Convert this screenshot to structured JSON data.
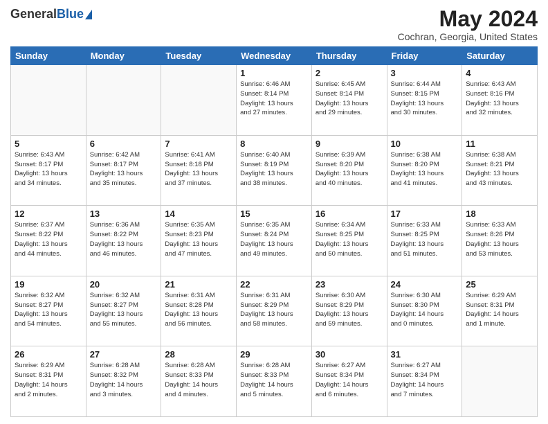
{
  "header": {
    "logo_general": "General",
    "logo_blue": "Blue",
    "month_title": "May 2024",
    "location": "Cochran, Georgia, United States"
  },
  "days_of_week": [
    "Sunday",
    "Monday",
    "Tuesday",
    "Wednesday",
    "Thursday",
    "Friday",
    "Saturday"
  ],
  "weeks": [
    [
      {
        "num": "",
        "info": ""
      },
      {
        "num": "",
        "info": ""
      },
      {
        "num": "",
        "info": ""
      },
      {
        "num": "1",
        "info": "Sunrise: 6:46 AM\nSunset: 8:14 PM\nDaylight: 13 hours\nand 27 minutes."
      },
      {
        "num": "2",
        "info": "Sunrise: 6:45 AM\nSunset: 8:14 PM\nDaylight: 13 hours\nand 29 minutes."
      },
      {
        "num": "3",
        "info": "Sunrise: 6:44 AM\nSunset: 8:15 PM\nDaylight: 13 hours\nand 30 minutes."
      },
      {
        "num": "4",
        "info": "Sunrise: 6:43 AM\nSunset: 8:16 PM\nDaylight: 13 hours\nand 32 minutes."
      }
    ],
    [
      {
        "num": "5",
        "info": "Sunrise: 6:43 AM\nSunset: 8:17 PM\nDaylight: 13 hours\nand 34 minutes."
      },
      {
        "num": "6",
        "info": "Sunrise: 6:42 AM\nSunset: 8:17 PM\nDaylight: 13 hours\nand 35 minutes."
      },
      {
        "num": "7",
        "info": "Sunrise: 6:41 AM\nSunset: 8:18 PM\nDaylight: 13 hours\nand 37 minutes."
      },
      {
        "num": "8",
        "info": "Sunrise: 6:40 AM\nSunset: 8:19 PM\nDaylight: 13 hours\nand 38 minutes."
      },
      {
        "num": "9",
        "info": "Sunrise: 6:39 AM\nSunset: 8:20 PM\nDaylight: 13 hours\nand 40 minutes."
      },
      {
        "num": "10",
        "info": "Sunrise: 6:38 AM\nSunset: 8:20 PM\nDaylight: 13 hours\nand 41 minutes."
      },
      {
        "num": "11",
        "info": "Sunrise: 6:38 AM\nSunset: 8:21 PM\nDaylight: 13 hours\nand 43 minutes."
      }
    ],
    [
      {
        "num": "12",
        "info": "Sunrise: 6:37 AM\nSunset: 8:22 PM\nDaylight: 13 hours\nand 44 minutes."
      },
      {
        "num": "13",
        "info": "Sunrise: 6:36 AM\nSunset: 8:22 PM\nDaylight: 13 hours\nand 46 minutes."
      },
      {
        "num": "14",
        "info": "Sunrise: 6:35 AM\nSunset: 8:23 PM\nDaylight: 13 hours\nand 47 minutes."
      },
      {
        "num": "15",
        "info": "Sunrise: 6:35 AM\nSunset: 8:24 PM\nDaylight: 13 hours\nand 49 minutes."
      },
      {
        "num": "16",
        "info": "Sunrise: 6:34 AM\nSunset: 8:25 PM\nDaylight: 13 hours\nand 50 minutes."
      },
      {
        "num": "17",
        "info": "Sunrise: 6:33 AM\nSunset: 8:25 PM\nDaylight: 13 hours\nand 51 minutes."
      },
      {
        "num": "18",
        "info": "Sunrise: 6:33 AM\nSunset: 8:26 PM\nDaylight: 13 hours\nand 53 minutes."
      }
    ],
    [
      {
        "num": "19",
        "info": "Sunrise: 6:32 AM\nSunset: 8:27 PM\nDaylight: 13 hours\nand 54 minutes."
      },
      {
        "num": "20",
        "info": "Sunrise: 6:32 AM\nSunset: 8:27 PM\nDaylight: 13 hours\nand 55 minutes."
      },
      {
        "num": "21",
        "info": "Sunrise: 6:31 AM\nSunset: 8:28 PM\nDaylight: 13 hours\nand 56 minutes."
      },
      {
        "num": "22",
        "info": "Sunrise: 6:31 AM\nSunset: 8:29 PM\nDaylight: 13 hours\nand 58 minutes."
      },
      {
        "num": "23",
        "info": "Sunrise: 6:30 AM\nSunset: 8:29 PM\nDaylight: 13 hours\nand 59 minutes."
      },
      {
        "num": "24",
        "info": "Sunrise: 6:30 AM\nSunset: 8:30 PM\nDaylight: 14 hours\nand 0 minutes."
      },
      {
        "num": "25",
        "info": "Sunrise: 6:29 AM\nSunset: 8:31 PM\nDaylight: 14 hours\nand 1 minute."
      }
    ],
    [
      {
        "num": "26",
        "info": "Sunrise: 6:29 AM\nSunset: 8:31 PM\nDaylight: 14 hours\nand 2 minutes."
      },
      {
        "num": "27",
        "info": "Sunrise: 6:28 AM\nSunset: 8:32 PM\nDaylight: 14 hours\nand 3 minutes."
      },
      {
        "num": "28",
        "info": "Sunrise: 6:28 AM\nSunset: 8:33 PM\nDaylight: 14 hours\nand 4 minutes."
      },
      {
        "num": "29",
        "info": "Sunrise: 6:28 AM\nSunset: 8:33 PM\nDaylight: 14 hours\nand 5 minutes."
      },
      {
        "num": "30",
        "info": "Sunrise: 6:27 AM\nSunset: 8:34 PM\nDaylight: 14 hours\nand 6 minutes."
      },
      {
        "num": "31",
        "info": "Sunrise: 6:27 AM\nSunset: 8:34 PM\nDaylight: 14 hours\nand 7 minutes."
      },
      {
        "num": "",
        "info": ""
      }
    ]
  ]
}
